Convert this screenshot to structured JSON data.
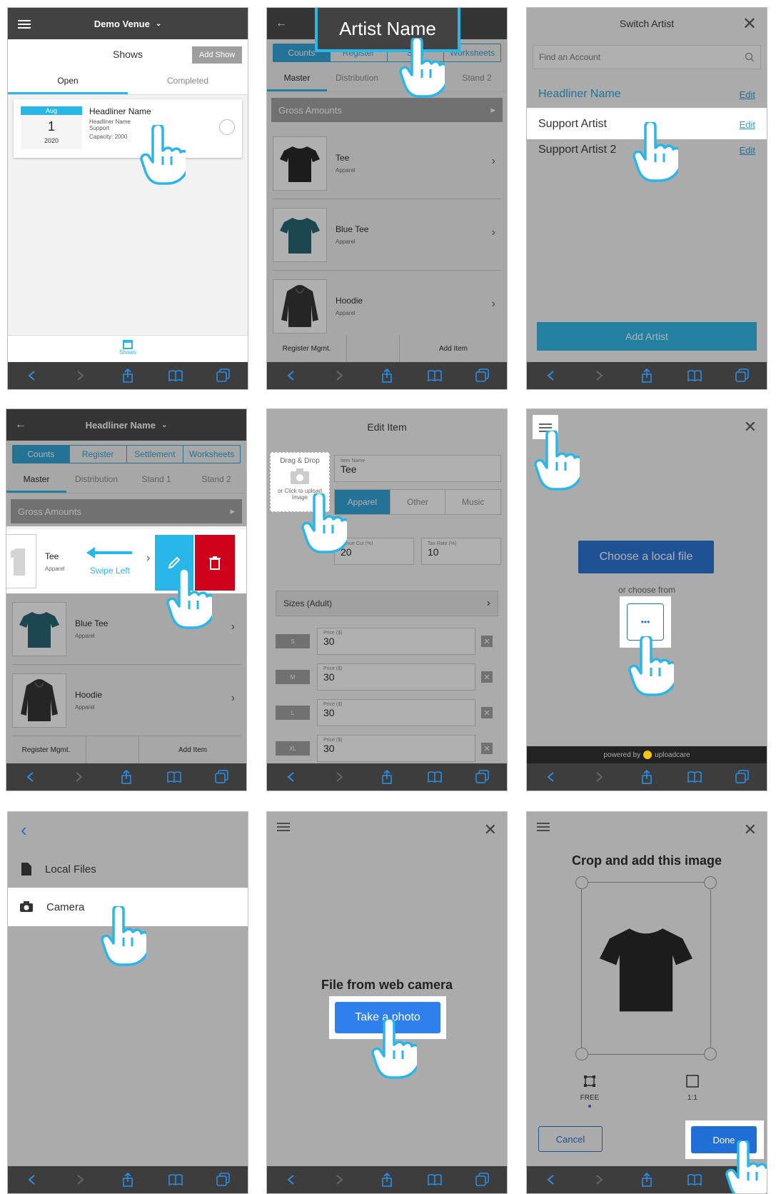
{
  "bottom_bar": {
    "icons": [
      "back-icon",
      "forward-icon",
      "share-icon",
      "bookmarks-icon",
      "tabs-icon"
    ]
  },
  "p1": {
    "header_title": "Demo Venue",
    "title": "Shows",
    "add_show": "Add Show",
    "tabs": [
      "Open",
      "Completed"
    ],
    "show": {
      "month": "Aug",
      "day": "1",
      "year": "2020",
      "headliner": "Headliner Name",
      "line1": "Headliner Name",
      "line2": "Support",
      "capacity": "Capacity: 2000"
    },
    "nav_label": "Shows"
  },
  "p2": {
    "callout": "Artist Name",
    "segments": [
      "Counts",
      "Register",
      "Settl",
      "Worksheets"
    ],
    "subtabs": [
      "Master",
      "Distribution",
      "S",
      "Stand 2"
    ],
    "gross": "Gross Amounts",
    "items": [
      {
        "name": "Tee",
        "category": "Apparel"
      },
      {
        "name": "Blue Tee",
        "category": "Apparel"
      },
      {
        "name": "Hoodie",
        "category": "Apparel"
      }
    ],
    "footer_left": "Register Mgmt.",
    "footer_right": "Add Item"
  },
  "p3": {
    "title": "Switch Artist",
    "search_placeholder": "Find an Account",
    "artists": [
      {
        "name": "Headliner Name",
        "edit": "Edit"
      },
      {
        "name": "Support Artist",
        "edit": "Edit"
      },
      {
        "name": "Support Artist 2",
        "edit": "Edit"
      }
    ],
    "add_artist": "Add Artist"
  },
  "p4": {
    "header_title": "Headliner Name",
    "segments": [
      "Counts",
      "Register",
      "Settlement",
      "Worksheets"
    ],
    "subtabs": [
      "Master",
      "Distribution",
      "Stand 1",
      "Stand 2"
    ],
    "gross": "Gross Amounts",
    "swipe_item": {
      "name": "Tee",
      "category": "Apparel"
    },
    "swipe_label": "Swipe Left",
    "items": [
      {
        "name": "Blue Tee",
        "category": "Apparel"
      },
      {
        "name": "Hoodie",
        "category": "Apparel"
      }
    ],
    "footer_left": "Register Mgmt.",
    "footer_right": "Add Item"
  },
  "p5": {
    "title": "Edit Item",
    "dropzone_title": "Drag & Drop",
    "dropzone_sub": "or Click to upload Image",
    "item_name_label": "Item Name",
    "item_name": "Tee",
    "types": [
      "Apparel",
      "Other",
      "Music"
    ],
    "venue_cut_label": "Venue Cut (%)",
    "venue_cut": "20",
    "tax_rate_label": "Tax Rate (%)",
    "tax_rate": "10",
    "sizes_header": "Sizes (Adult)",
    "sizes": [
      {
        "size": "S",
        "price_label": "Price ($)",
        "price": "30"
      },
      {
        "size": "M",
        "price_label": "Price ($)",
        "price": "30"
      },
      {
        "size": "L",
        "price_label": "Price ($)",
        "price": "30"
      },
      {
        "size": "XL",
        "price_label": "Price ($)",
        "price": "30"
      }
    ]
  },
  "p6": {
    "choose_local": "Choose a local file",
    "or_choose": "or choose from",
    "more": "•••",
    "powered_by": "powered by",
    "brand": "uploadcare"
  },
  "p7": {
    "sources": [
      {
        "label": "Local Files",
        "icon": "file-icon"
      },
      {
        "label": "Camera",
        "icon": "camera-icon"
      }
    ]
  },
  "p8": {
    "heading": "File from web camera",
    "take_photo": "Take a photo"
  },
  "p9": {
    "heading": "Crop and add this image",
    "options": [
      {
        "label": "FREE"
      },
      {
        "label": "1:1"
      }
    ],
    "cancel": "Cancel",
    "done": "Done"
  },
  "colors": {
    "accent": "#29b6e8",
    "primary_blue": "#1f6fd6",
    "delete_red": "#d0021b",
    "dark_bar": "#424242"
  }
}
